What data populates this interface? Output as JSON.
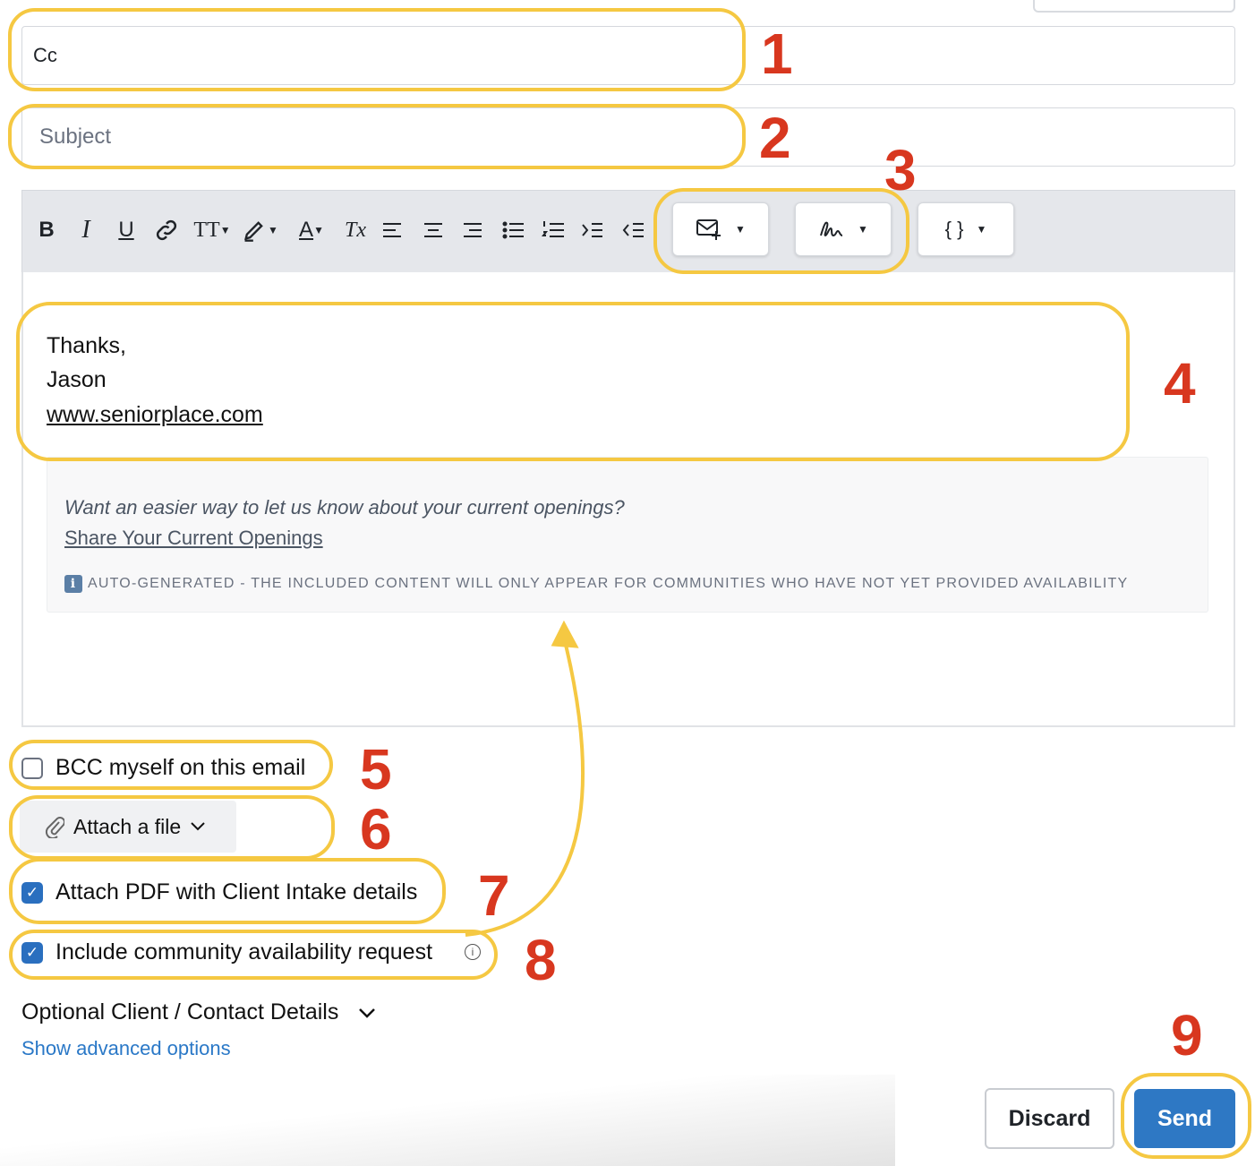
{
  "fields": {
    "cc_label": "Cc",
    "subject_placeholder": "Subject"
  },
  "toolbar": {
    "bold": "B",
    "italic": "I",
    "underline": "U",
    "text_size": "TT",
    "font_color": "A",
    "clear_format": "Tx",
    "template_icon": "envelope-plus-icon",
    "signature_icon": "signature-icon",
    "variables_label": "{ }"
  },
  "editor": {
    "signature": {
      "line1": "Thanks,",
      "line2": "Jason",
      "link": "www.seniorplace.com"
    },
    "auto_block": {
      "question": "Want an easier way to let us know about your current openings?",
      "link": "Share Your Current Openings",
      "note": "AUTO-GENERATED - THE INCLUDED CONTENT WILL ONLY APPEAR FOR COMMUNITIES WHO HAVE NOT YET PROVIDED AVAILABILITY",
      "info_glyph": "i"
    }
  },
  "options": {
    "bcc_label": "BCC myself on this email",
    "bcc_checked": false,
    "attach_label": "Attach a file",
    "pdf_label": "Attach PDF with Client Intake details",
    "pdf_checked": true,
    "availability_label": "Include community availability request",
    "availability_checked": true
  },
  "footer": {
    "optional_details": "Optional Client / Contact Details",
    "advanced_link": "Show advanced options",
    "discard": "Discard",
    "send": "Send"
  },
  "annotations": [
    "1",
    "2",
    "3",
    "4",
    "5",
    "6",
    "7",
    "8",
    "9"
  ],
  "colors": {
    "highlight": "#f5c842",
    "number": "#d8371f",
    "primary": "#2e78c4",
    "link": "#2a78c7"
  }
}
